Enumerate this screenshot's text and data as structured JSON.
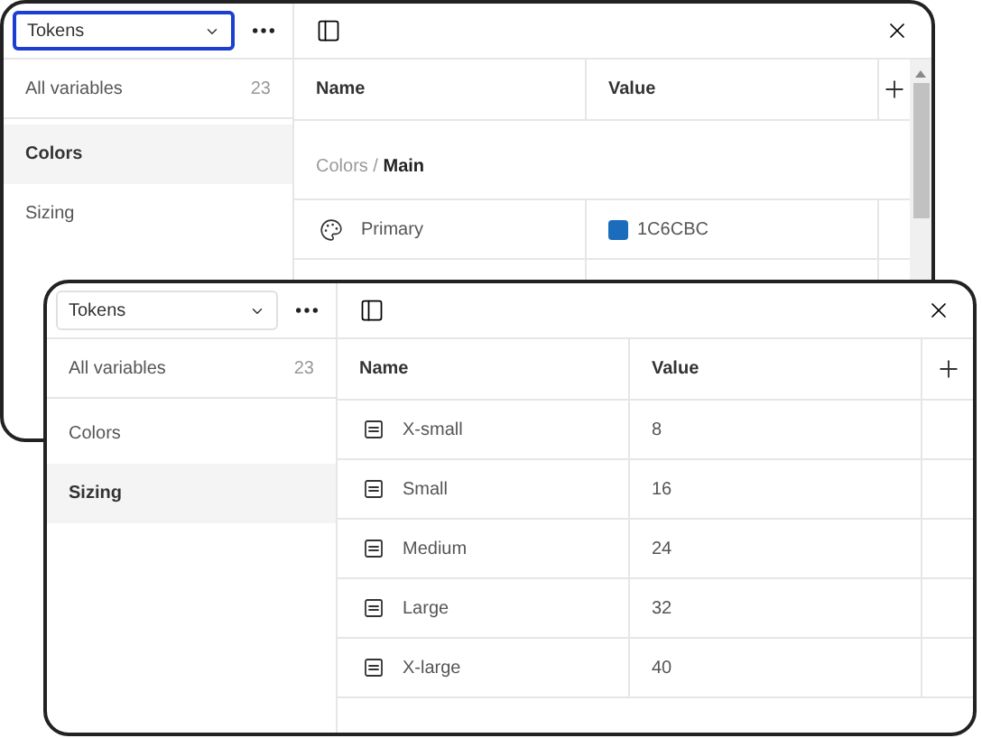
{
  "windows": [
    {
      "selector": {
        "value": "Tokens",
        "focused": true
      },
      "sidebar": {
        "items": [
          {
            "label": "All variables",
            "count": "23",
            "selected": false
          },
          {
            "label": "Colors",
            "selected": true
          },
          {
            "label": "Sizing",
            "selected": false
          }
        ]
      },
      "table": {
        "columns": [
          "Name",
          "Value"
        ],
        "group": "Colors / **Main**",
        "rows": [
          {
            "kind": "color",
            "name": "Primary",
            "value": "1C6CBC",
            "color": "#1c6cbc"
          }
        ]
      }
    },
    {
      "selector": {
        "value": "Tokens",
        "focused": false
      },
      "sidebar": {
        "items": [
          {
            "label": "All variables",
            "count": "23",
            "selected": false
          },
          {
            "label": "Colors",
            "selected": false
          },
          {
            "label": "Sizing",
            "selected": true
          }
        ]
      },
      "table": {
        "columns": [
          "Name",
          "Value"
        ],
        "rows": [
          {
            "kind": "number",
            "name": "X-small",
            "value": "8"
          },
          {
            "kind": "number",
            "name": "Small",
            "value": "16"
          },
          {
            "kind": "number",
            "name": "Medium",
            "value": "24"
          },
          {
            "kind": "number",
            "name": "Large",
            "value": "32"
          },
          {
            "kind": "number",
            "name": "X-large",
            "value": "40"
          }
        ]
      }
    }
  ]
}
